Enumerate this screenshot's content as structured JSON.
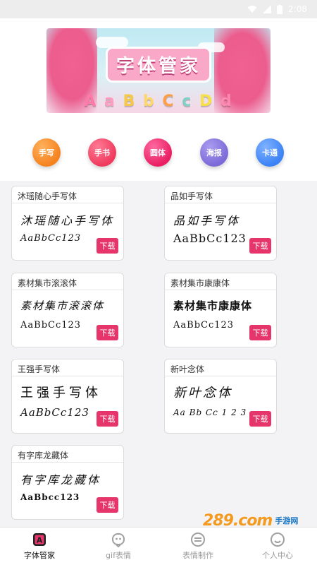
{
  "banner": {
    "title": "字体管家",
    "letters": [
      "A",
      "a",
      "B",
      "b",
      "C",
      "c",
      "D",
      "d"
    ]
  },
  "categories": [
    {
      "label": "手写",
      "color": "#f5821f"
    },
    {
      "label": "手书",
      "color": "#ef3a5d"
    },
    {
      "label": "圆体",
      "color": "#e91e63"
    },
    {
      "label": "海报",
      "color": "#7b6ad8"
    },
    {
      "label": "卡通",
      "color": "#3b82f6"
    }
  ],
  "fonts": [
    {
      "name": "沐瑶随心手写体",
      "sample": "沐瑶随心手写体",
      "alphabet": "AaBbCc123",
      "download": "下载"
    },
    {
      "name": "品如手写体",
      "sample": "品如手写体",
      "alphabet": "AaBbCc123",
      "download": "下载"
    },
    {
      "name": "素材集市滚滚体",
      "sample": "素材集市滚滚体",
      "alphabet": "AaBbCc123",
      "download": "下载"
    },
    {
      "name": "素材集市康康体",
      "sample": "素材集市康康体",
      "alphabet": "AaBbCc123",
      "download": "下载"
    },
    {
      "name": "王强手写体",
      "sample": "王强手写体",
      "alphabet": "AaBbCc123",
      "download": "下载"
    },
    {
      "name": "新叶念体",
      "sample": "新叶念体",
      "alphabet": "Aa Bb Cc 1 2 3",
      "download": "下载"
    },
    {
      "name": "有字库龙藏体",
      "sample": "有字库龙藏体",
      "alphabet": "AaBbcc123",
      "download": "下载"
    }
  ],
  "tabbar": [
    {
      "label": "字体管家",
      "icon": "font-a-icon",
      "active": true
    },
    {
      "label": "gif表情",
      "icon": "face-icon",
      "active": false
    },
    {
      "label": "表情制作",
      "icon": "edit-icon",
      "active": false
    },
    {
      "label": "个人中心",
      "icon": "user-icon",
      "active": false
    }
  ],
  "watermark": {
    "brand": "289.com",
    "sub": "手游网"
  },
  "status": {
    "time": "2:08"
  }
}
